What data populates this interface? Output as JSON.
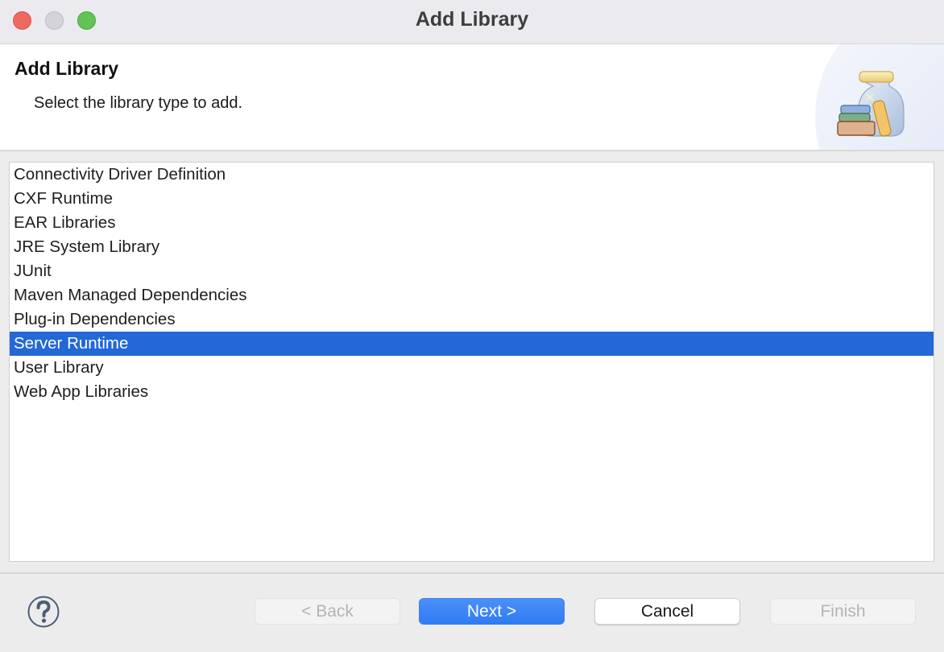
{
  "window": {
    "title": "Add Library"
  },
  "header": {
    "title": "Add Library",
    "description": "Select the library type to add.",
    "icon": "library-jar-icon"
  },
  "library_types": {
    "items": [
      {
        "label": "Connectivity Driver Definition",
        "selected": false
      },
      {
        "label": "CXF Runtime",
        "selected": false
      },
      {
        "label": "EAR Libraries",
        "selected": false
      },
      {
        "label": "JRE System Library",
        "selected": false
      },
      {
        "label": "JUnit",
        "selected": false
      },
      {
        "label": "Maven Managed Dependencies",
        "selected": false
      },
      {
        "label": "Plug-in Dependencies",
        "selected": false
      },
      {
        "label": "Server Runtime",
        "selected": true
      },
      {
        "label": "User Library",
        "selected": false
      },
      {
        "label": "Web App Libraries",
        "selected": false
      }
    ]
  },
  "footer": {
    "help_icon": "help-icon",
    "back_label": "< Back",
    "next_label": "Next >",
    "cancel_label": "Cancel",
    "finish_label": "Finish",
    "back_enabled": false,
    "finish_enabled": false
  },
  "colors": {
    "selection": "#2368d6",
    "primary_button": "#2f7cf3"
  }
}
